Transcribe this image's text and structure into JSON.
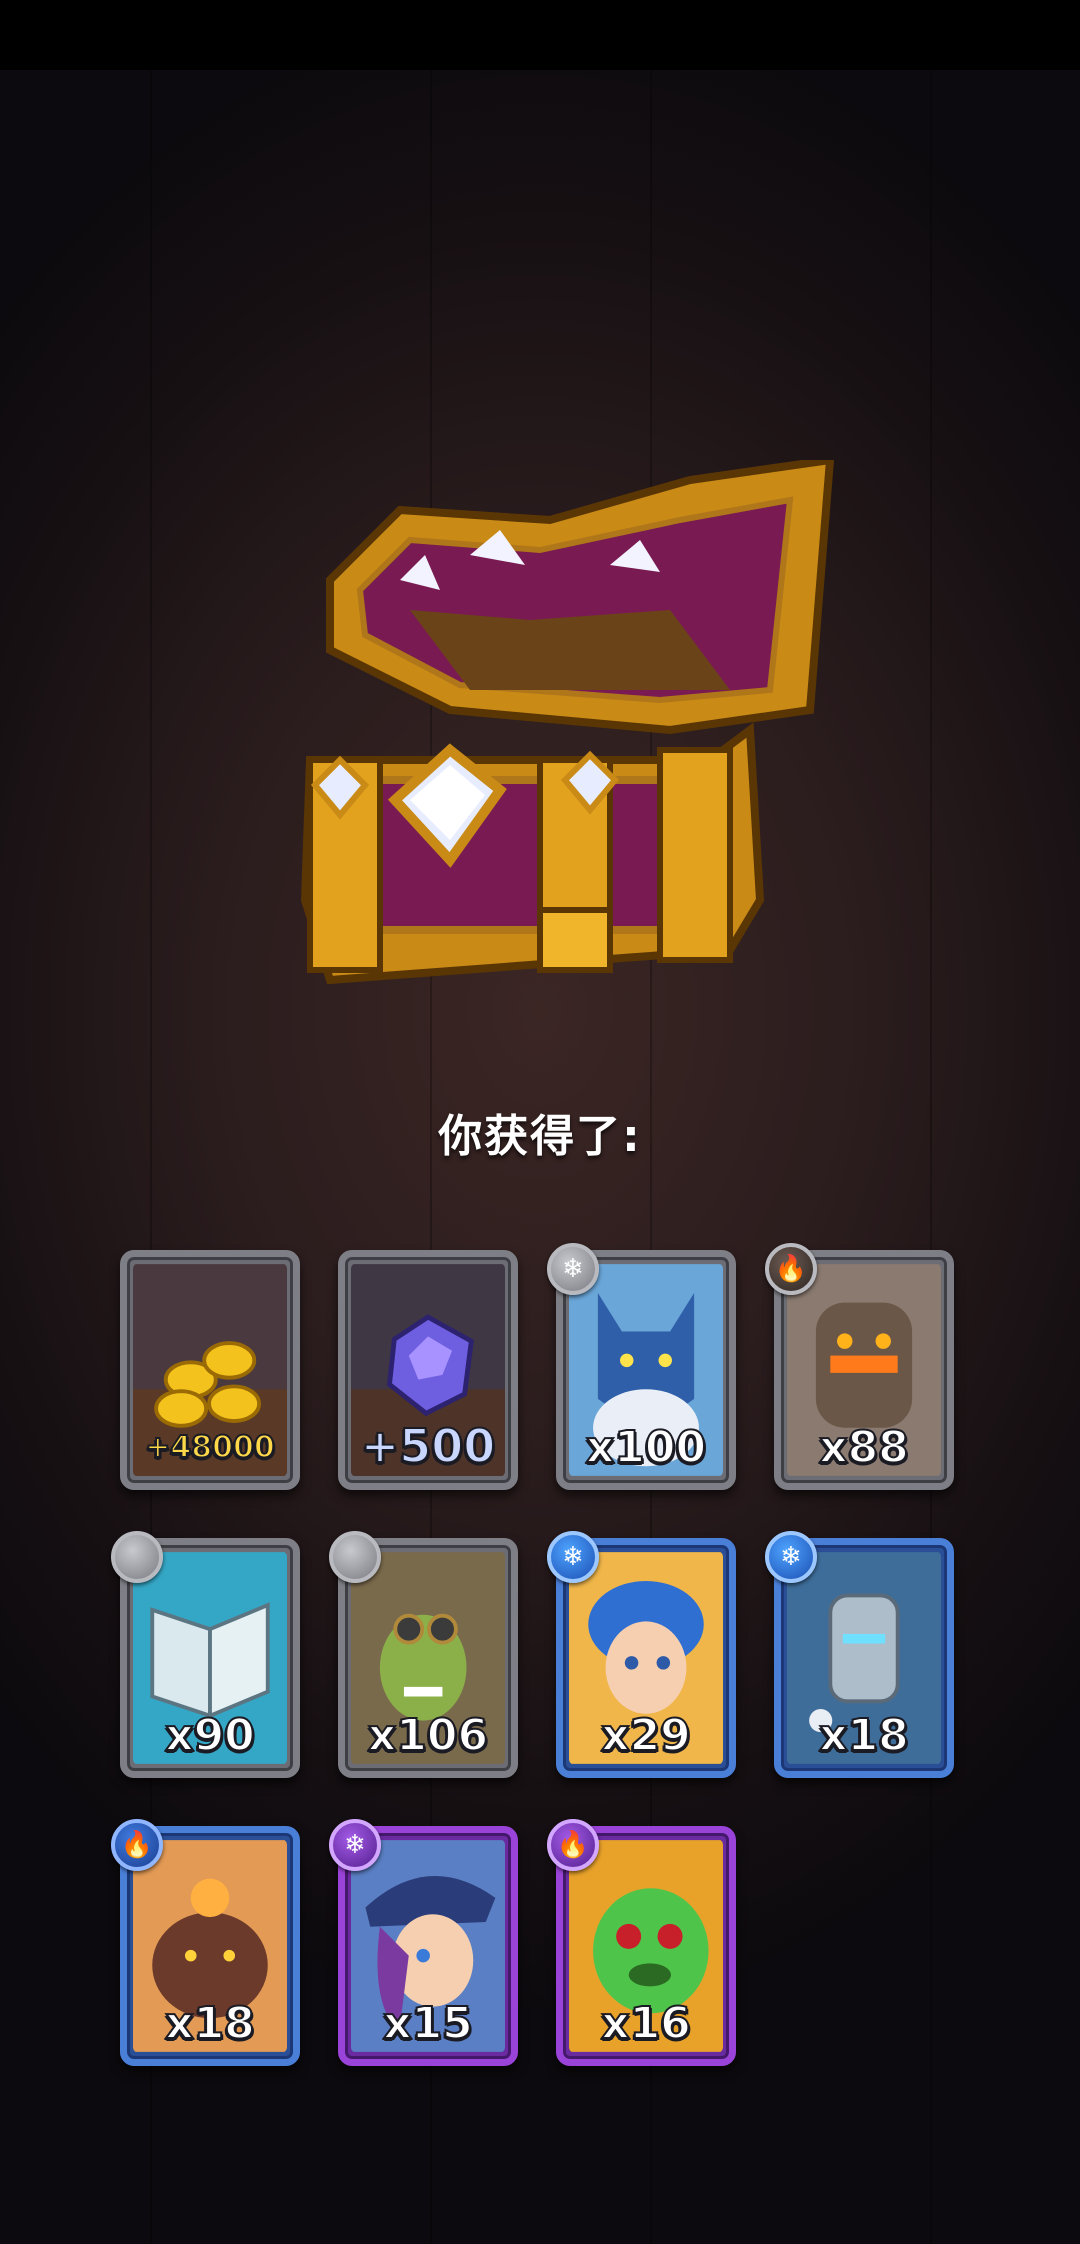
{
  "title": "你获得了:",
  "chest": {
    "icon": "treasure-chest-icon"
  },
  "rewards": [
    {
      "name": "gold-coins",
      "label": "+48000",
      "rarity": "common",
      "element": null,
      "icon": "gold-coins-icon"
    },
    {
      "name": "purple-crystal",
      "label": "+500",
      "rarity": "common",
      "element": null,
      "icon": "crystal-icon"
    },
    {
      "name": "blue-wolf",
      "label": "x100",
      "rarity": "common",
      "element": "ice",
      "icon": "wolf-icon"
    },
    {
      "name": "stone-golem",
      "label": "x88",
      "rarity": "common",
      "element": "fire",
      "icon": "golem-icon"
    },
    {
      "name": "taptap-book",
      "label": "x90",
      "rarity": "common",
      "element": "neutral",
      "icon": "book-icon"
    },
    {
      "name": "goblin-pilot",
      "label": "x106",
      "rarity": "common",
      "element": "neutral",
      "icon": "goblin-icon"
    },
    {
      "name": "blue-hair-hero",
      "label": "x29",
      "rarity": "rare",
      "element": "ice",
      "icon": "hero-icon"
    },
    {
      "name": "ice-knight",
      "label": "x18",
      "rarity": "rare",
      "element": "ice",
      "icon": "knight-icon"
    },
    {
      "name": "fire-beast",
      "label": "x18",
      "rarity": "rare",
      "element": "fire",
      "icon": "beast-icon"
    },
    {
      "name": "pirate-girl",
      "label": "x15",
      "rarity": "epic",
      "element": "ice",
      "icon": "pirate-icon"
    },
    {
      "name": "green-monster",
      "label": "x16",
      "rarity": "epic",
      "element": "fire",
      "icon": "monster-icon"
    }
  ]
}
